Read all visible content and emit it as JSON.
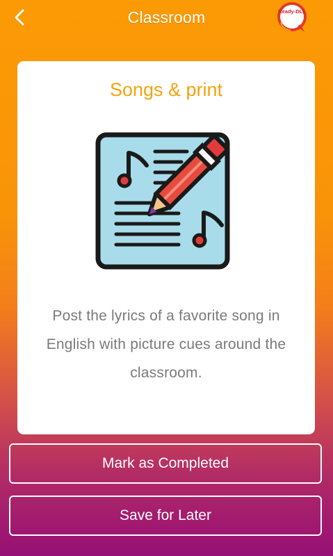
{
  "header": {
    "title": "Classroom",
    "back_icon": "chevron-left-icon",
    "logo_text": "Ready-DLL"
  },
  "card": {
    "title": "Songs & print",
    "illustration": "lyrics-sheet-pencil-icon",
    "description": "Post the lyrics of a favorite song in English with picture cues around the classroom."
  },
  "actions": {
    "mark_completed_label": "Mark as Completed",
    "save_later_label": "Save for Later"
  },
  "colors": {
    "card_title": "#f3a40e",
    "gradient_top": "#fb9a05",
    "gradient_bottom": "#960f75"
  }
}
